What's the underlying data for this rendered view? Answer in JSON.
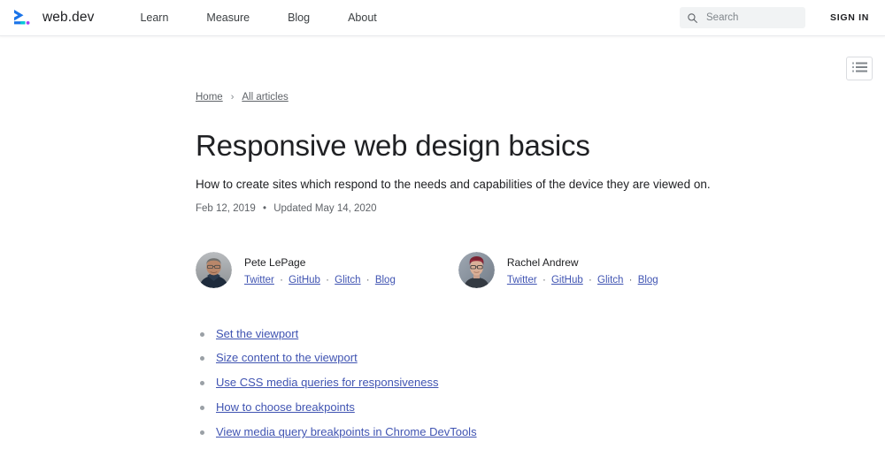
{
  "header": {
    "brand": {
      "logo_icon": "web-dev-chevron-logo",
      "name": "web.dev",
      "logo_colors": {
        "chevron": "#1a73e8",
        "accent": "#00c8d7",
        "dot": "#a142f4"
      }
    },
    "nav": [
      {
        "label": "Learn"
      },
      {
        "label": "Measure"
      },
      {
        "label": "Blog"
      },
      {
        "label": "About"
      }
    ],
    "search": {
      "icon": "search-icon",
      "placeholder": "Search",
      "value": ""
    },
    "signin_label": "SIGN IN"
  },
  "toc_toggle": {
    "icon": "list-view-icon",
    "title": "Table of contents"
  },
  "breadcrumb": {
    "items": [
      {
        "label": "Home"
      },
      {
        "label": "All articles"
      }
    ],
    "separator": "›"
  },
  "article": {
    "title": "Responsive web design basics",
    "subtitle": "How to create sites which respond to the needs and capabilities of the device they are viewed on.",
    "published": "Feb 12, 2019",
    "meta_dot": "•",
    "updated": "Updated May 14, 2020"
  },
  "authors": [
    {
      "name": "Pete LePage",
      "avatar": "pete-lepage-avatar",
      "links": [
        {
          "label": "Twitter"
        },
        {
          "label": "GitHub"
        },
        {
          "label": "Glitch"
        },
        {
          "label": "Blog"
        }
      ]
    },
    {
      "name": "Rachel Andrew",
      "avatar": "rachel-andrew-avatar",
      "links": [
        {
          "label": "Twitter"
        },
        {
          "label": "GitHub"
        },
        {
          "label": "Glitch"
        },
        {
          "label": "Blog"
        }
      ]
    }
  ],
  "link_separator": "·",
  "toc": [
    {
      "label": "Set the viewport"
    },
    {
      "label": "Size content to the viewport"
    },
    {
      "label": "Use CSS media queries for responsiveness"
    },
    {
      "label": "How to choose breakpoints"
    },
    {
      "label": "View media query breakpoints in Chrome DevTools"
    }
  ],
  "colors": {
    "link": "#4054b2",
    "text": "#202124",
    "muted": "#5f6368",
    "search_bg": "#f1f3f4",
    "border": "#e8eaed"
  }
}
